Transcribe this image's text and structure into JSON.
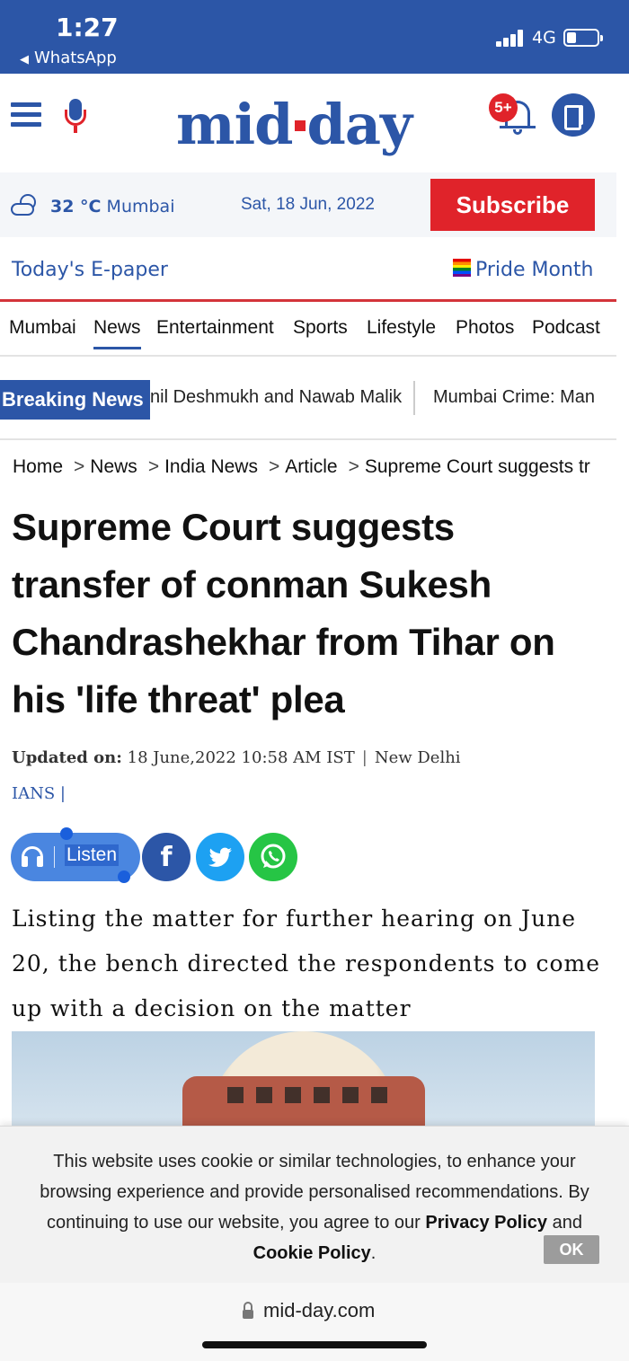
{
  "status_bar": {
    "time": "1:27",
    "back_app": "WhatsApp",
    "network": "4G"
  },
  "header": {
    "logo_left": "mid",
    "logo_right": "day",
    "notification_count": "5+"
  },
  "info_bar": {
    "temperature": "32 °C",
    "city": "Mumbai",
    "date": "Sat, 18 Jun, 2022",
    "subscribe_label": "Subscribe"
  },
  "epaper_row": {
    "epaper_label": "Today's E-paper",
    "pride_label": "Pride Month"
  },
  "nav": {
    "items": [
      "Mumbai",
      "News",
      "Entertainment",
      "Sports",
      "Lifestyle",
      "Photos",
      "Podcast"
    ],
    "active": "News"
  },
  "breaking": {
    "tag": "Breaking News",
    "ticker": [
      "nil Deshmukh and Nawab Malik",
      "Mumbai Crime: Man"
    ]
  },
  "breadcrumb": [
    "Home",
    "News",
    "India News",
    "Article",
    "Supreme Court suggests tr"
  ],
  "article": {
    "headline": "Supreme Court suggests transfer of conman Sukesh Chandrashekhar from Tihar on his 'life threat' plea",
    "updated_label": "Updated on:",
    "updated_value": "18 June,2022 10:58 AM IST",
    "location": "New Delhi",
    "agency": "IANS",
    "listen_label": "Listen",
    "summary": "Listing the matter for further hearing on June 20, the bench directed the respondents to come up with a decision on the matter"
  },
  "cookie": {
    "text_before": "This website uses cookie or similar technologies, to enhance your browsing experience and provide personalised recommendations. By continuing to use our website, you agree to our ",
    "privacy_link": "Privacy Policy",
    "and": "and",
    "cookie_link": "Cookie Policy",
    "period": ".",
    "ok_label": "OK"
  },
  "browser": {
    "url": "mid-day.com"
  },
  "colors": {
    "brand_blue": "#2c56a7",
    "brand_red": "#e0232a",
    "twitter": "#1da1f2",
    "whatsapp": "#26c545"
  },
  "icons": [
    "hamburger-menu-icon",
    "microphone-icon",
    "bell-icon",
    "reader-icon",
    "weather-icon",
    "pride-flag-icon",
    "headphones-icon",
    "facebook-icon",
    "twitter-icon",
    "whatsapp-icon",
    "lock-icon"
  ]
}
